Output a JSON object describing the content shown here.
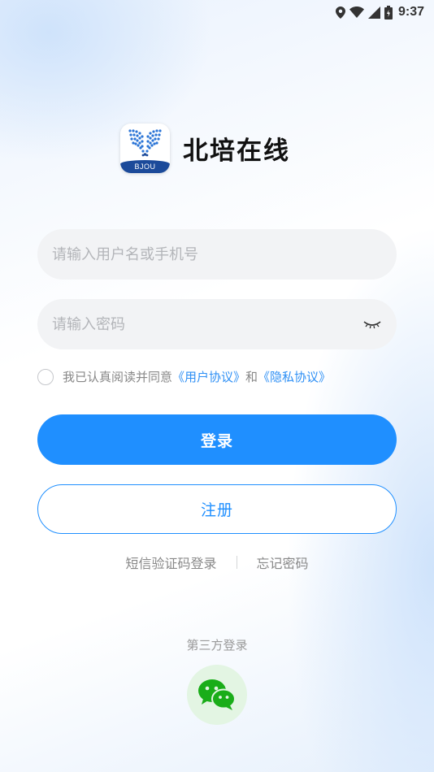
{
  "status_bar": {
    "time": "9:37"
  },
  "brand": {
    "app_name": "北培在线",
    "logo_text": "BJOU"
  },
  "username": {
    "placeholder": "请输入用户名或手机号",
    "value": ""
  },
  "password": {
    "placeholder": "请输入密码",
    "value": ""
  },
  "agreement": {
    "prefix": "我已认真阅读并同意",
    "user_agreement": "《用户协议》",
    "conjunction": "和",
    "privacy_policy": "《隐私协议》",
    "checked": false
  },
  "actions": {
    "login_label": "登录",
    "register_label": "注册",
    "sms_login_label": "短信验证码登录",
    "forgot_password_label": "忘记密码"
  },
  "third_party": {
    "label": "第三方登录",
    "icon": "wechat-icon"
  },
  "colors": {
    "primary": "#1f8fff",
    "link": "#2f90f5",
    "wechat": "#1aad19"
  }
}
